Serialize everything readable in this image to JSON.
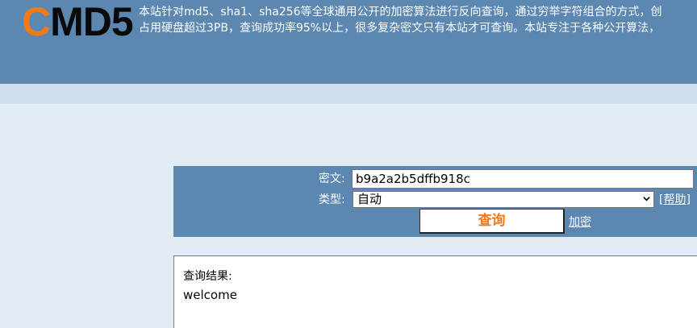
{
  "header": {
    "logo_first": "C",
    "logo_rest": "MD5",
    "intro_line1": "本站针对md5、sha1、sha256等全球通用公开的加密算法进行反向查询，通过穷举字符组合的方式，创",
    "intro_line2": "占用硬盘超过3PB，查询成功率95%以上，很多复杂密文只有本站才可查询。本站专注于各种公开算法，"
  },
  "form": {
    "cipher_label": "密文:",
    "cipher_value": "b9a2a2b5dffb918c",
    "type_label": "类型:",
    "type_selected": "自动",
    "help_link": "[帮助]",
    "query_button": "查询",
    "encrypt_link": "加密"
  },
  "result": {
    "label": "查询结果:",
    "value": "welcome"
  },
  "colors": {
    "header_bg": "#5b87b1",
    "subbar_bg": "#cfe0ee",
    "page_bg": "#e1ecf4",
    "accent_orange": "#f07a1a"
  },
  "icons": {
    "select_arrow": "chevron-down-icon"
  }
}
